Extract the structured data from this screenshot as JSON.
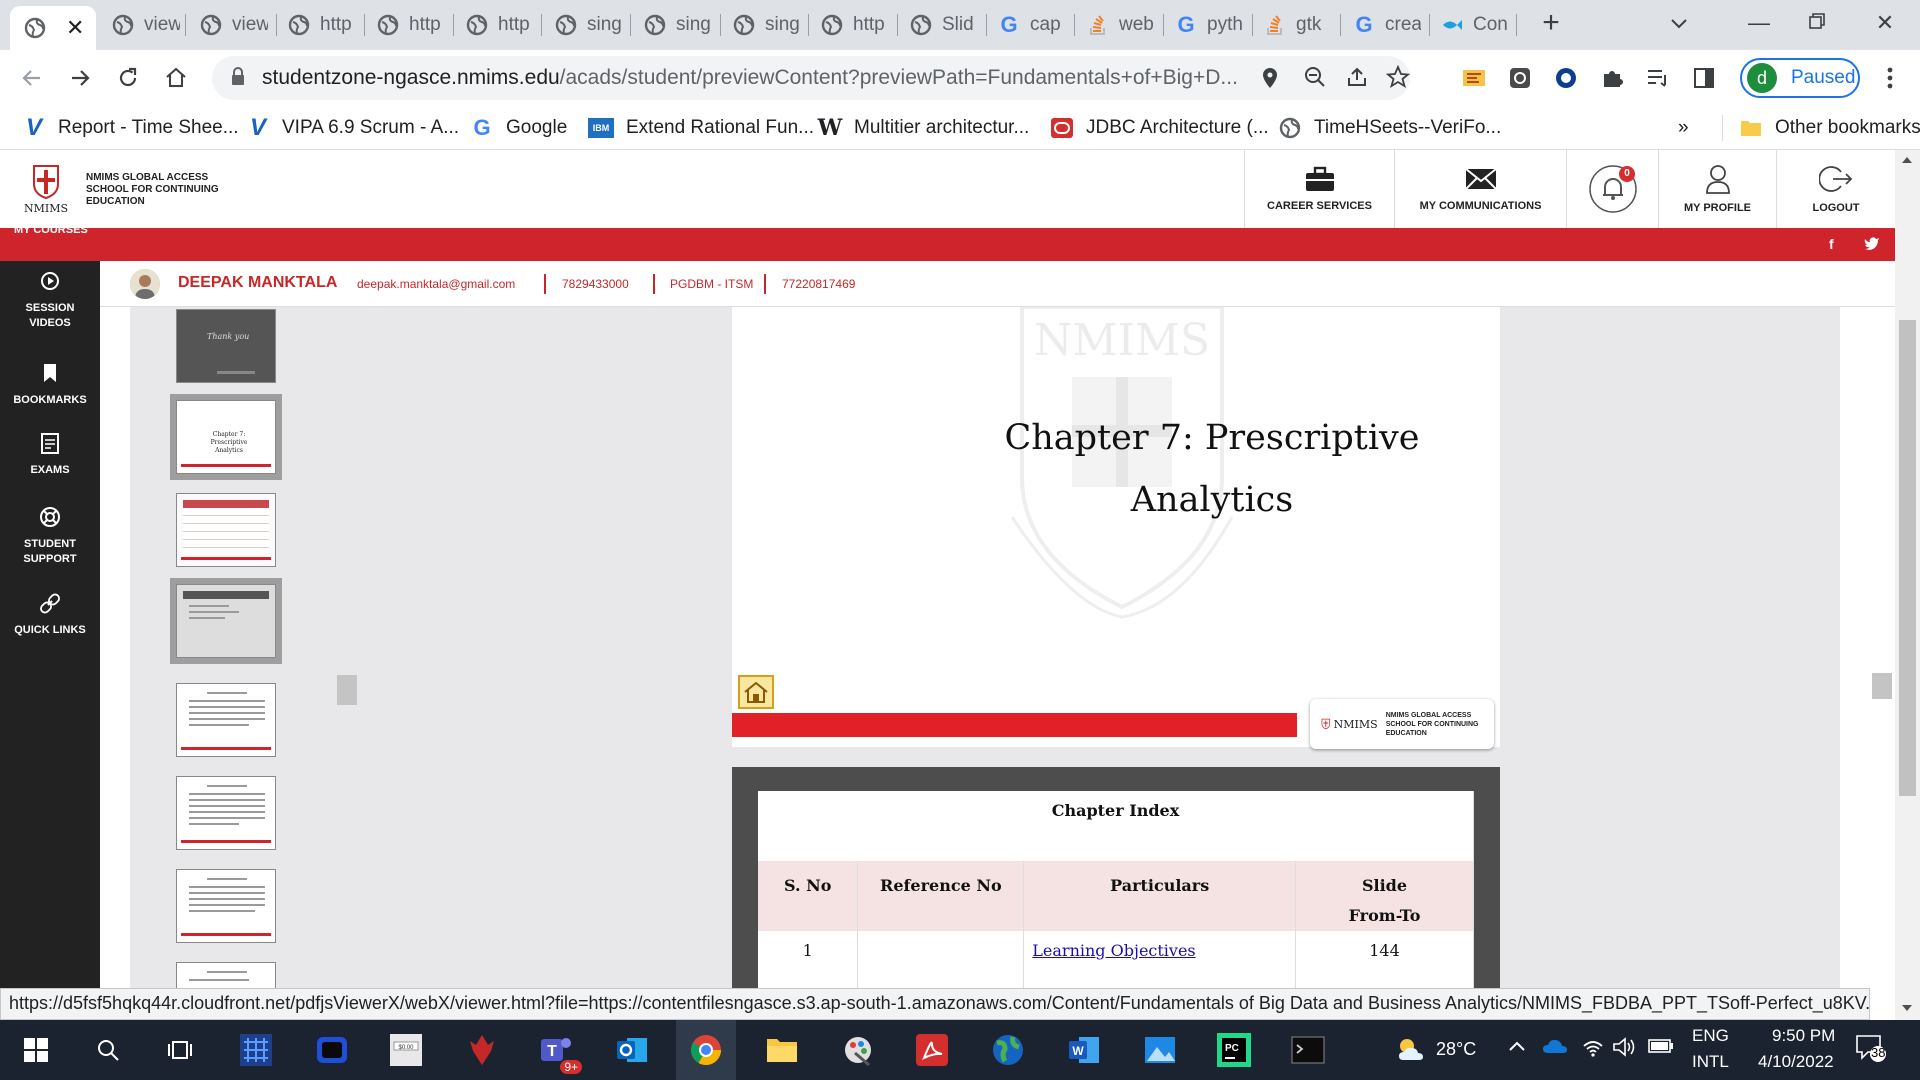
{
  "browser": {
    "tabs": [
      {
        "label": "",
        "icon": "globe-icon",
        "active": true
      },
      {
        "label": "view",
        "icon": "globe-icon"
      },
      {
        "label": "view",
        "icon": "globe-icon"
      },
      {
        "label": "http",
        "icon": "globe-icon"
      },
      {
        "label": "http",
        "icon": "globe-icon"
      },
      {
        "label": "http",
        "icon": "globe-icon"
      },
      {
        "label": "sing",
        "icon": "globe-icon"
      },
      {
        "label": "sing",
        "icon": "globe-icon"
      },
      {
        "label": "sing",
        "icon": "globe-icon"
      },
      {
        "label": "http",
        "icon": "globe-icon"
      },
      {
        "label": "Slid",
        "icon": "globe-icon"
      },
      {
        "label": "cap",
        "icon": "google-icon"
      },
      {
        "label": "web",
        "icon": "stackoverflow-icon"
      },
      {
        "label": "pyth",
        "icon": "google-icon"
      },
      {
        "label": "gtk",
        "icon": "stackoverflow-icon"
      },
      {
        "label": "crea",
        "icon": "google-icon"
      },
      {
        "label": "Con",
        "icon": "fish-icon"
      }
    ],
    "url_host": "studentzone-ngasce.nmims.edu",
    "url_path": "/acads/student/previewContent?previewPath=Fundamentals+of+Big+D...",
    "profile_initial": "d",
    "profile_label": "Paused",
    "bookmarks": [
      {
        "label": "Report - Time Shee...",
        "icon": "v-icon"
      },
      {
        "label": "VIPA 6.9 Scrum - A...",
        "icon": "v-icon"
      },
      {
        "label": "Google",
        "icon": "google-icon"
      },
      {
        "label": "Extend Rational Fun...",
        "icon": "ibm-icon"
      },
      {
        "label": "Multitier architectur...",
        "icon": "wikipedia-icon"
      },
      {
        "label": "JDBC Architecture (...",
        "icon": "jdbc-icon"
      },
      {
        "label": "TimeHSeets--VeriFo...",
        "icon": "globe-icon"
      }
    ],
    "bookmarks_overflow": "»",
    "other_bookmarks": "Other bookmarks"
  },
  "site": {
    "logo_name": "NMIMS",
    "logo_text": "NMIMS GLOBAL ACCESS SCHOOL FOR CONTINUING EDUCATION",
    "nav": [
      {
        "label": "CAREER SERVICES",
        "icon": "briefcase-icon"
      },
      {
        "label": "MY COMMUNICATIONS",
        "icon": "envelope-icon"
      },
      {
        "label": "",
        "icon": "bell-icon",
        "badge": "0"
      },
      {
        "label": "MY PROFILE",
        "icon": "user-icon"
      },
      {
        "label": "LOGOUT",
        "icon": "logout-icon"
      }
    ],
    "my_courses": "MY COURSES",
    "sidebar": [
      {
        "label": "SESSION VIDEOS",
        "icon": "play-icon"
      },
      {
        "label": "BOOKMARKS",
        "icon": "bookmark-icon"
      },
      {
        "label": "EXAMS",
        "icon": "exam-icon"
      },
      {
        "label": "STUDENT SUPPORT",
        "icon": "lifebuoy-icon"
      },
      {
        "label": "QUICK LINKS",
        "icon": "link-icon"
      }
    ]
  },
  "student": {
    "name": "DEEPAK MANKTALA",
    "email": "deepak.manktala@gmail.com",
    "phone": "7829433000",
    "program": "PGDBM - ITSM",
    "id": "77220817469"
  },
  "slide": {
    "title_line1": "Chapter 7: Prescriptive",
    "title_line2": "Analytics",
    "footer_logo": "NMIMS",
    "footer_logo_text": "NMIMS GLOBAL ACCESS SCHOOL FOR CONTINUING EDUCATION",
    "thumb_thanks": "Thank you",
    "thumb_chapter": "Chapter 7: Prescriptive Analytics",
    "watermark": "SVKM'S NMIMS Deemed to be UNIVERSITY"
  },
  "chapter_index": {
    "caption": "Chapter Index",
    "headers": [
      "S. No",
      "Reference No",
      "Particulars",
      "Slide From-To"
    ],
    "rows": [
      {
        "sno": "1",
        "ref": "",
        "particulars": "Learning Objectives",
        "slides": "144"
      }
    ]
  },
  "status_url": "https://d5fsf5hqkq44r.cloudfront.net/pdfjsViewerX/webX/viewer.html?file=https://contentfilesngasce.s3.ap-south-1.amazonaws.com/Content/Fundamentals of Big Data and Business Analytics/NMIMS_FBDBA_PPT_TSoff-Perfect_u8KV...",
  "taskbar": {
    "weather": "28°C",
    "lang1": "ENG",
    "lang2": "INTL",
    "time": "9:50 PM",
    "date": "4/10/2022",
    "notif_count": "38",
    "teams_badge": "9+"
  },
  "colors": {
    "brand_red": "#d0242c",
    "sidebar_bg": "#222222",
    "table_header": "#c8484c"
  }
}
